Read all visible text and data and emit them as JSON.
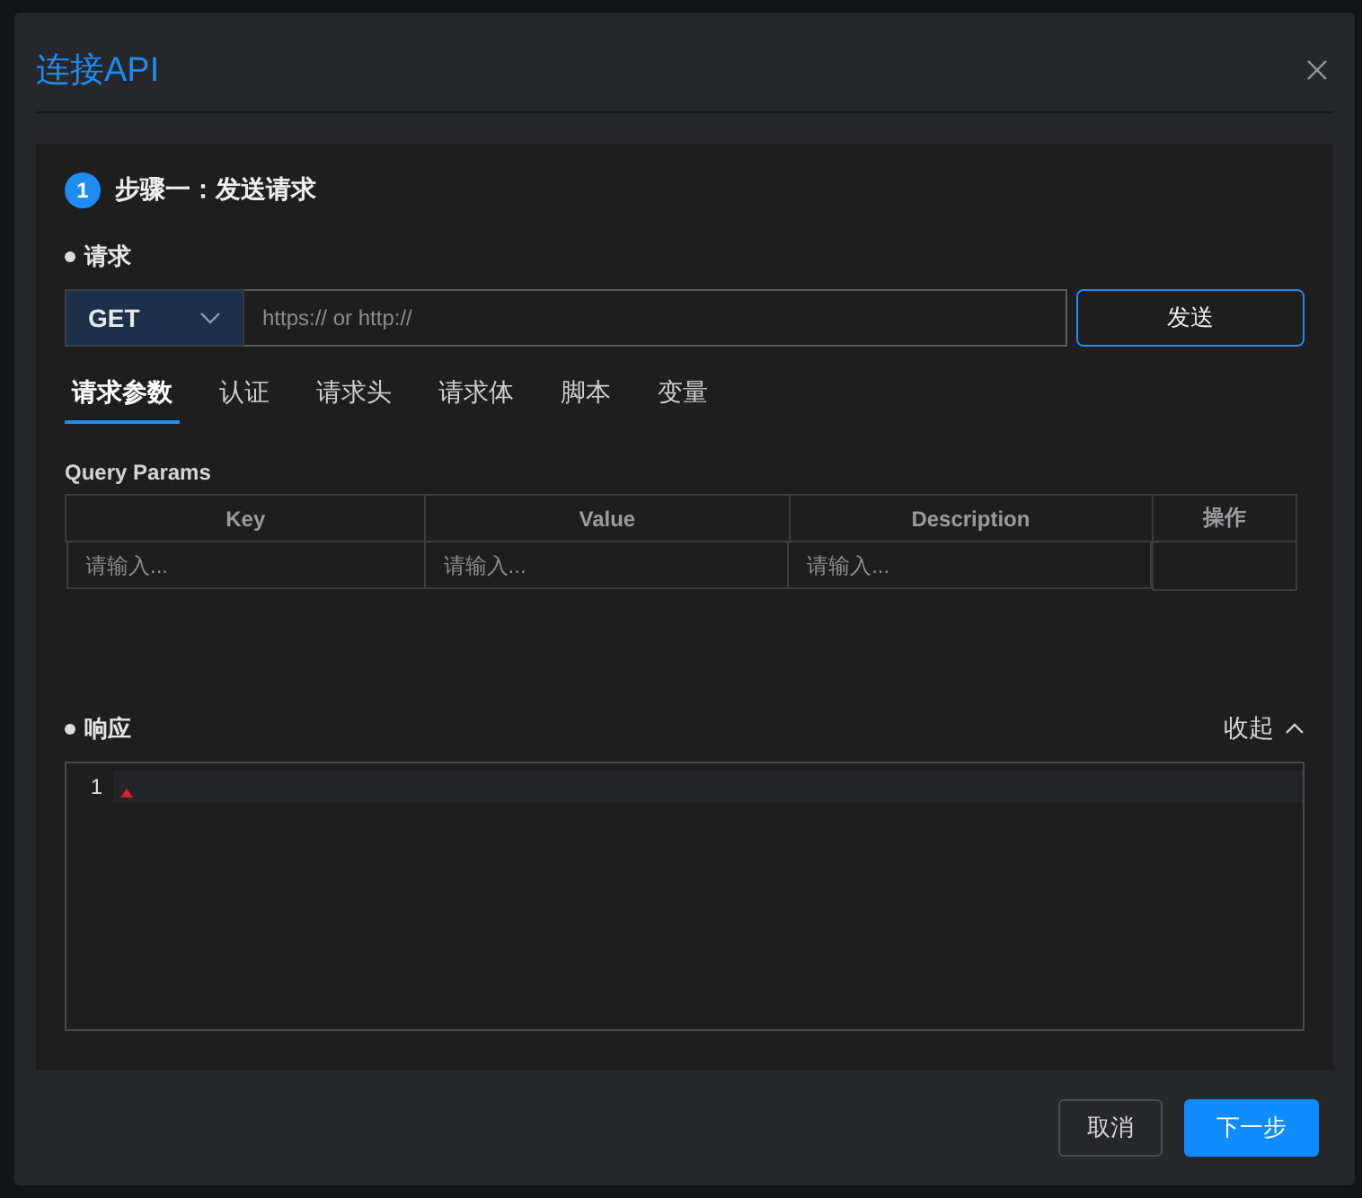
{
  "dialog": {
    "title": "连接API",
    "step": {
      "number": "1",
      "title": "步骤一：发送请求"
    },
    "request": {
      "label": "请求",
      "method": "GET",
      "url": {
        "placeholder": "https:// or http://"
      },
      "send_button": "发送"
    },
    "tabs": [
      {
        "label": "请求参数",
        "selected": true
      },
      {
        "label": "认证",
        "selected": false
      },
      {
        "label": "请求头",
        "selected": false
      },
      {
        "label": "请求体",
        "selected": false
      },
      {
        "label": "脚本",
        "selected": false
      },
      {
        "label": "变量",
        "selected": false
      }
    ],
    "params": {
      "title": "Query Params",
      "columns": [
        "Key",
        "Value",
        "Description",
        "操作"
      ],
      "rows": [
        {
          "key": {
            "placeholder": "请输入..."
          },
          "value": {
            "placeholder": "请输入..."
          },
          "description": {
            "placeholder": "请输入..."
          }
        }
      ]
    },
    "response": {
      "label": "响应",
      "toggle": "收起",
      "expanded": true,
      "editor": {
        "lines": [
          "1"
        ]
      }
    },
    "buttons": [
      {
        "label": "取消",
        "kind": "secondary"
      },
      {
        "label": "下一步",
        "kind": "primary"
      }
    ]
  }
}
